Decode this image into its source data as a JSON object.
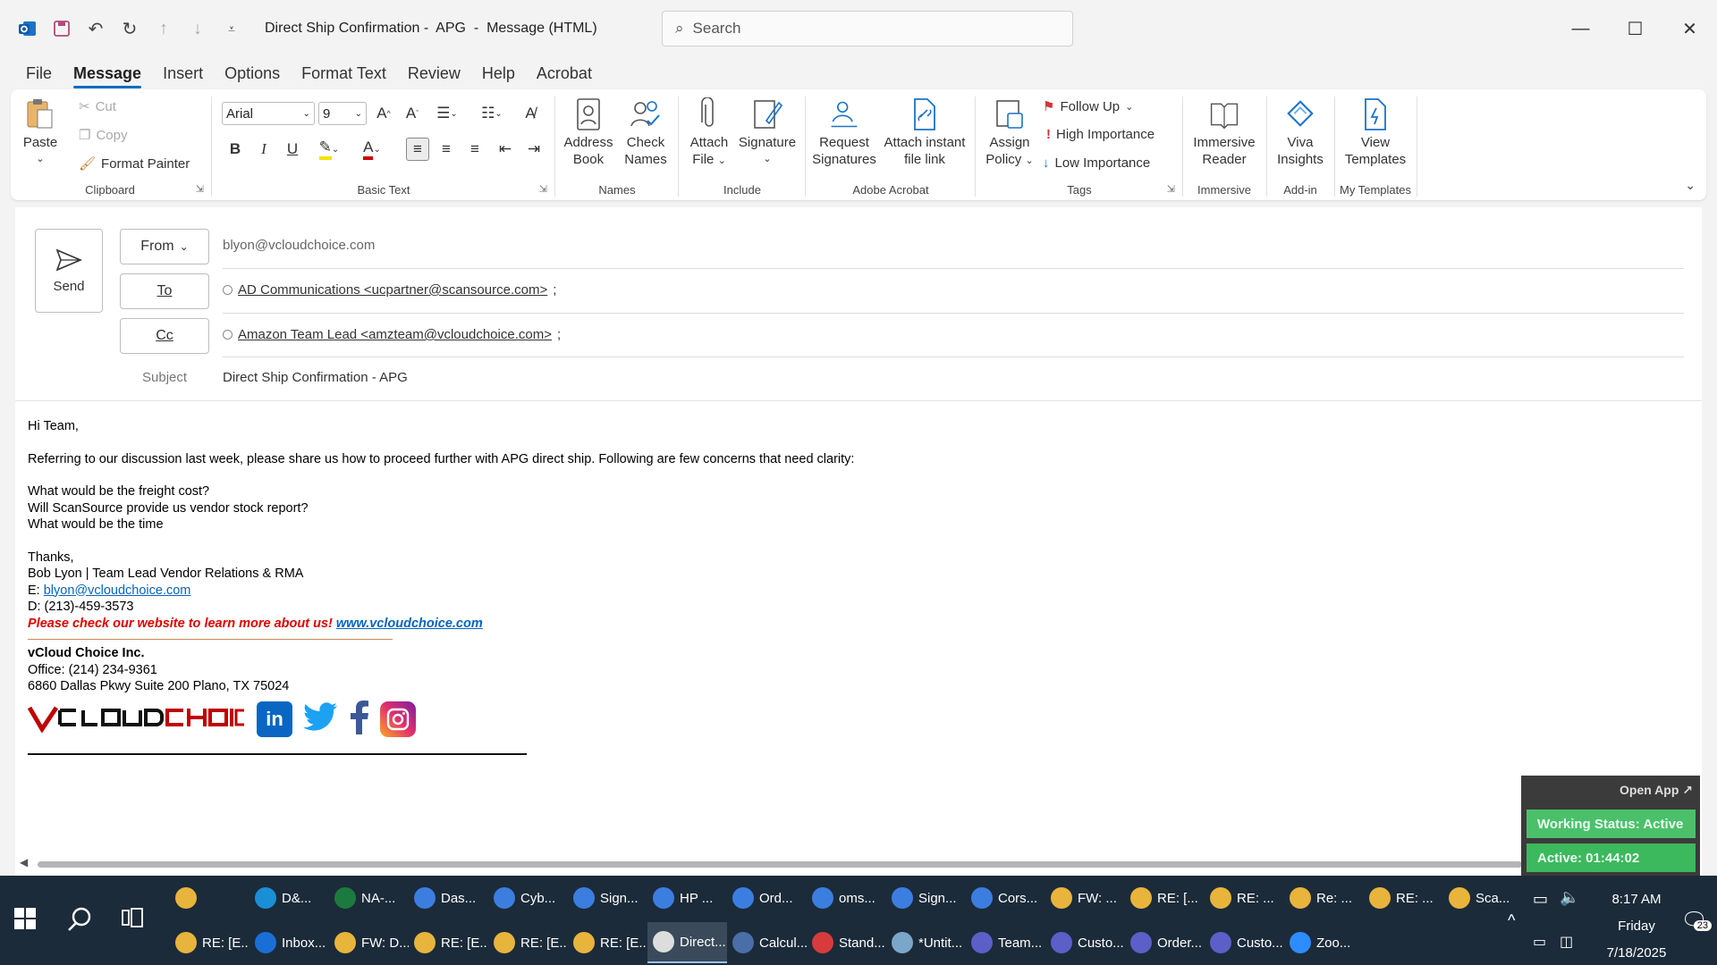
{
  "window": {
    "title": "Direct Ship Confirmation -  APG  -  Message (HTML)",
    "search_placeholder": "Search"
  },
  "menu": {
    "tabs": [
      {
        "label": "File"
      },
      {
        "label": "Message",
        "active": true
      },
      {
        "label": "Insert"
      },
      {
        "label": "Options"
      },
      {
        "label": "Format Text"
      },
      {
        "label": "Review"
      },
      {
        "label": "Help"
      },
      {
        "label": "Acrobat"
      }
    ]
  },
  "ribbon": {
    "clipboard": {
      "paste": "Paste",
      "cut": "Cut",
      "copy": "Copy",
      "format_painter": "Format Painter",
      "label": "Clipboard"
    },
    "basic_text": {
      "font": "Arial",
      "size": "9",
      "label": "Basic Text"
    },
    "names": {
      "address_book": [
        "Address",
        "Book"
      ],
      "check_names": [
        "Check",
        "Names"
      ],
      "label": "Names"
    },
    "include": {
      "attach_file": [
        "Attach",
        "File"
      ],
      "signature": [
        "Signature",
        ""
      ],
      "label": "Include"
    },
    "adobe": {
      "request_signatures": [
        "Request",
        "Signatures"
      ],
      "attach_link": [
        "Attach instant",
        "file link"
      ],
      "label": "Adobe Acrobat"
    },
    "tags": {
      "assign_policy": [
        "Assign",
        "Policy"
      ],
      "follow_up": "Follow Up",
      "high_importance": "High Importance",
      "low_importance": "Low Importance",
      "label": "Tags"
    },
    "immersive": {
      "reader": [
        "Immersive",
        "Reader"
      ],
      "label": "Immersive"
    },
    "addin": {
      "viva": [
        "Viva",
        "Insights"
      ],
      "label": "Add-in"
    },
    "templates": {
      "view": [
        "View",
        "Templates"
      ],
      "label": "My Templates"
    }
  },
  "compose": {
    "send_label": "Send",
    "from_label": "From",
    "from_value": "blyon@vcloudchoice.com",
    "to_label": "To",
    "to_value": "AD Communications <ucpartner@scansource.com>",
    "cc_label": "Cc",
    "cc_value": "Amazon Team Lead <amzteam@vcloudchoice.com>",
    "subject_label": "Subject",
    "subject_value": "Direct Ship Confirmation -  APG"
  },
  "body": {
    "greeting": "Hi Team,",
    "intro": "Referring to our discussion last week, please share us how to proceed further with APG direct ship. Following are few concerns that need clarity:",
    "q1": "What would be the freight cost?",
    "q2": "Will ScanSource provide us vendor stock report?",
    "q3": "What would be the time",
    "thanks": "Thanks,",
    "sig_name": "Bob Lyon | Team Lead Vendor Relations & RMA",
    "sig_email_prefix": "E: ",
    "sig_email": "blyon@vcloudchoice.com",
    "sig_phone": "D: (213)-459-3573",
    "promo": "Please check our website to learn more about us!",
    "website": "www.vcloudchoice.com",
    "company": "vCloud Choice Inc.",
    "office": "Office: (214) 234-9361",
    "address": "6860 Dallas Pkwy Suite 200 Plano, TX 75024"
  },
  "widget": {
    "open_app": "Open App ↗",
    "working_status": "Working Status: Active",
    "active_time": "Active: 01:44:02"
  },
  "taskbar": {
    "row1": [
      {
        "label": "",
        "color": "#e8b43c"
      },
      {
        "label": "D&...",
        "color": "#1a8fd6"
      },
      {
        "label": "NA-...",
        "color": "#1d7a3e"
      },
      {
        "label": "Das...",
        "color": "#3b7ee0"
      },
      {
        "label": "Cyb...",
        "color": "#3b7ee0"
      },
      {
        "label": "Sign...",
        "color": "#3b7ee0"
      },
      {
        "label": "HP ...",
        "color": "#3b7ee0"
      },
      {
        "label": "Ord...",
        "color": "#3b7ee0"
      },
      {
        "label": "oms...",
        "color": "#3b7ee0"
      },
      {
        "label": "Sign...",
        "color": "#3b7ee0"
      },
      {
        "label": "Cors...",
        "color": "#3b7ee0"
      },
      {
        "label": "FW: ...",
        "color": "#e8b43c"
      },
      {
        "label": "RE: [...",
        "color": "#e8b43c"
      },
      {
        "label": "RE: ...",
        "color": "#e8b43c"
      },
      {
        "label": "Re: ...",
        "color": "#e8b43c"
      },
      {
        "label": "RE: ...",
        "color": "#e8b43c"
      },
      {
        "label": "Sca...",
        "color": "#e8b43c"
      }
    ],
    "row2": [
      {
        "label": "RE: [E...",
        "color": "#e8b43c"
      },
      {
        "label": "Inbox...",
        "color": "#1a6fd6"
      },
      {
        "label": "FW: D...",
        "color": "#e8b43c"
      },
      {
        "label": "RE: [E...",
        "color": "#e8b43c"
      },
      {
        "label": "RE: [E...",
        "color": "#e8b43c"
      },
      {
        "label": "RE: [E...",
        "color": "#e8b43c"
      },
      {
        "label": "Direct...",
        "color": "#dddddd",
        "active": true
      },
      {
        "label": "Calcul...",
        "color": "#4a6ea8"
      },
      {
        "label": "Stand...",
        "color": "#d83b3b"
      },
      {
        "label": "*Untit...",
        "color": "#7aa7c9"
      },
      {
        "label": "Team...",
        "color": "#5b5fc7"
      },
      {
        "label": "Custo...",
        "color": "#5b5fc7"
      },
      {
        "label": "Order...",
        "color": "#5b5fc7"
      },
      {
        "label": "Custo...",
        "color": "#5b5fc7"
      },
      {
        "label": "Zoo...",
        "color": "#2d8cff"
      }
    ],
    "time": "8:17 AM",
    "day": "Friday",
    "date": "7/18/2025",
    "notifications": "23"
  }
}
